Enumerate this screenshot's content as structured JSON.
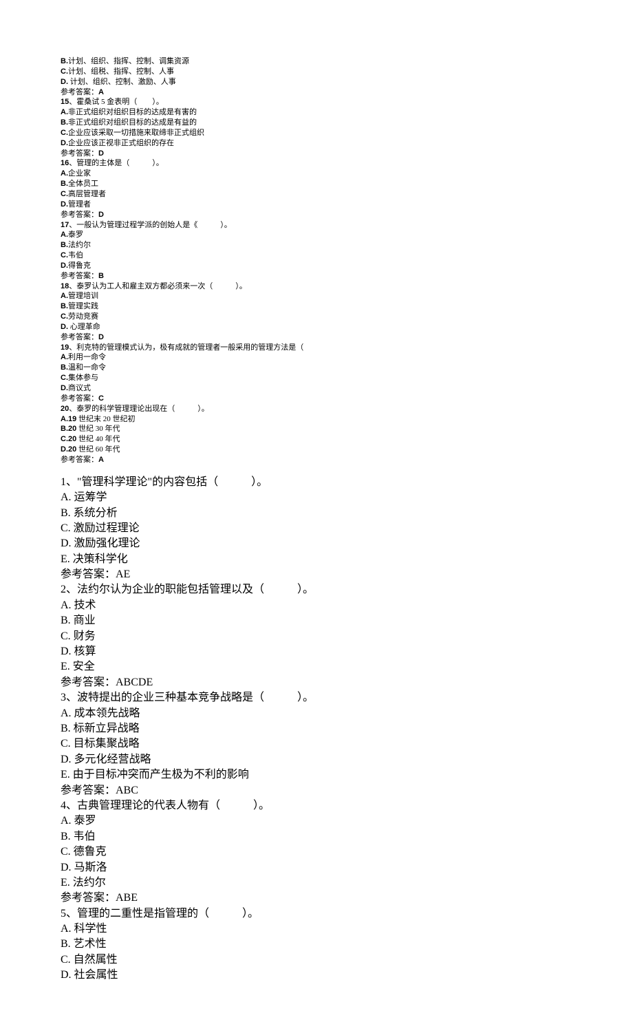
{
  "section1": {
    "q14": {
      "optB": {
        "prefix": "B.",
        "text": "计划、组织、指挥、控制、调集资源"
      },
      "optC": {
        "prefix": "C.",
        "text": "计划、组税、指挥、控制、人事"
      },
      "optD": {
        "prefix": "D.",
        "text": " 计划、组织、控制、激励、人事"
      },
      "ansLabel": "参考答案：",
      "ans": "A"
    },
    "q15": {
      "num": "15",
      "stem": "、霍桑试 5 金表明（　　）。",
      "optA": {
        "prefix": "A.",
        "text": "非正式组织对组织目标的达成是有害的"
      },
      "optB": {
        "prefix": "B.",
        "text": "非正式组织对组织目标的达成是有益的"
      },
      "optC": {
        "prefix": "C.",
        "text": "企业应该采取一切措施来取缔非正式组织"
      },
      "optD": {
        "prefix": "D.",
        "text": "企业应该正视非正式组织的存在"
      },
      "ansLabel": "参考答案：",
      "ans": "D"
    },
    "q16": {
      "num": "16",
      "stem": "、管理的主体是（　　　）。",
      "optA": {
        "prefix": "A.",
        "text": "企业家"
      },
      "optB": {
        "prefix": "B.",
        "text": "全体员工"
      },
      "optC": {
        "prefix": "C.",
        "text": "高层管理者"
      },
      "optD": {
        "prefix": "D.",
        "text": "管理者"
      },
      "ansLabel": "参考答案：",
      "ans": "D"
    },
    "q17": {
      "num": "17",
      "stem": "、一般认为管理过程学派的创始人是《　　　）。",
      "optA": {
        "prefix": "A.",
        "text": "泰罗"
      },
      "optB": {
        "prefix": "B.",
        "text": "法约尔"
      },
      "optC": {
        "prefix": "C.",
        "text": "韦伯"
      },
      "optD": {
        "prefix": "D.",
        "text": "得鲁克"
      },
      "ansLabel": "参考答案：",
      "ans": "B"
    },
    "q18": {
      "num": "18",
      "stem": "、泰罗认为工人和雇主双方都必须来一次（　　　）。",
      "optA": {
        "prefix": "A.",
        "text": "管理培训"
      },
      "optB": {
        "prefix": "B.",
        "text": "管理实践"
      },
      "optC": {
        "prefix": "C.",
        "text": "劳动竞赛"
      },
      "optD": {
        "prefix": "D.",
        "text": " 心理革命"
      },
      "ansLabel": "参考答案：",
      "ans": "D"
    },
    "q19": {
      "num": "19",
      "stem": "、利克特的管理模式认为，极有成就的管理者一般采用的管理方法是（",
      "optA": {
        "prefix": "A.",
        "text": "利用一命令"
      },
      "optB": {
        "prefix": "B.",
        "text": "温和一命令"
      },
      "optC": {
        "prefix": "C.",
        "text": "集体参与"
      },
      "optD": {
        "prefix": "D.",
        "text": "商议式"
      },
      "ansLabel": "参考答案：",
      "ans": "C"
    },
    "q20": {
      "num": "20",
      "stem": "、泰罗的科学管理理论出现在（　　　）。",
      "optA": {
        "prefix": "A.19",
        "text": " 世纪末 20 世纪初"
      },
      "optB": {
        "prefix": "B.20",
        "text": " 世纪 30 年代"
      },
      "optC": {
        "prefix": "C.20",
        "text": " 世纪 40 年代"
      },
      "optD": {
        "prefix": "D.20",
        "text": " 世纪 60 年代"
      },
      "ansLabel": "参考答案：",
      "ans": "A"
    }
  },
  "section2": {
    "q1": {
      "stem": "1、\"管理科学理论\"的内容包括（　　　）。",
      "optA": "A. 运筹学",
      "optB": "B. 系统分析",
      "optC": "C. 激励过程理论",
      "optD": "D. 激励强化理论",
      "optE": "E. 决策科学化",
      "ans": "参考答案：AE"
    },
    "q2": {
      "stem": "2、法约尔认为企业的职能包括管理以及（　　　）。",
      "optA": "A. 技术",
      "optB": "B. 商业",
      "optC": "C. 财务",
      "optD": "D. 核算",
      "optE": "E. 安全",
      "ans": "参考答案：ABCDE"
    },
    "q3": {
      "stem": "3、波特提出的企业三种基本竞争战略是（　　　）。",
      "optA": "A. 成本领先战略",
      "optB": "B. 标新立异战略",
      "optC": "C. 目标集聚战略",
      "optD": "D. 多元化经营战略",
      "optE": "E. 由于目标冲突而产生极为不利的影响",
      "ans": "参考答案：ABC"
    },
    "q4": {
      "stem": "4、古典管理理论的代表人物有（　　　）。",
      "optA": "A. 泰罗",
      "optB": "B. 韦伯",
      "optC": "C. 德鲁克",
      "optD": "D. 马斯洛",
      "optE": "E. 法约尔",
      "ans": "参考答案：ABE"
    },
    "q5": {
      "stem": "5、管理的二重性是指管理的（　　　）。",
      "optA": "A. 科学性",
      "optB": "B. 艺术性",
      "optC": "C. 自然属性",
      "optD": "D. 社会属性"
    }
  }
}
